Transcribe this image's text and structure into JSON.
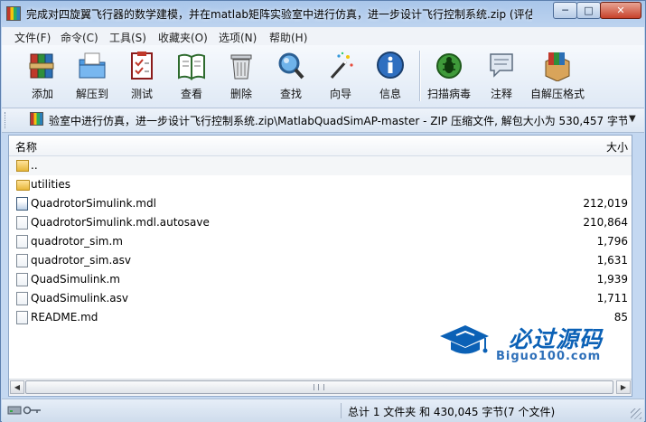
{
  "window": {
    "title": "完成对四旋翼飞行器的数学建模，并在matlab矩阵实验室中进行仿真，进一步设计飞行控制系统.zip (评估",
    "minimize": "─",
    "maximize": "□",
    "close": "✕"
  },
  "menu": [
    "文件(F)",
    "命令(C)",
    "工具(S)",
    "收藏夹(O)",
    "选项(N)",
    "帮助(H)"
  ],
  "toolbar": {
    "add": "添加",
    "extract": "解压到",
    "test": "测试",
    "view": "查看",
    "delete": "删除",
    "find": "查找",
    "wizard": "向导",
    "info": "信息",
    "scan": "扫描病毒",
    "comment": "注释",
    "sfx": "自解压格式"
  },
  "address": {
    "path": "验室中进行仿真，进一步设计飞行控制系统.zip\\MatlabQuadSimAP-master - ZIP 压缩文件, 解包大小为 530,457 字节",
    "dropdown": "▼"
  },
  "list": {
    "col_name": "名称",
    "col_size": "大小",
    "files": [
      {
        "name": "..",
        "size": "",
        "type": "up"
      },
      {
        "name": "utilities",
        "size": "",
        "type": "folder"
      },
      {
        "name": "QuadrotorSimulink.mdl",
        "size": "212,019",
        "type": "mdl"
      },
      {
        "name": "QuadrotorSimulink.mdl.autosave",
        "size": "210,864",
        "type": "doc"
      },
      {
        "name": "quadrotor_sim.m",
        "size": "1,796",
        "type": "doc"
      },
      {
        "name": "quadrotor_sim.asv",
        "size": "1,631",
        "type": "doc"
      },
      {
        "name": "QuadSimulink.m",
        "size": "1,939",
        "type": "doc"
      },
      {
        "name": "QuadSimulink.asv",
        "size": "1,711",
        "type": "doc"
      },
      {
        "name": "README.md",
        "size": "85",
        "type": "doc"
      }
    ]
  },
  "watermark": {
    "title": "必过源码",
    "subtitle": "Biguo100.com"
  },
  "scroll": {
    "left": "◀",
    "right": "▶"
  },
  "status": {
    "summary": "总计 1 文件夹 和 430,045 字节(7 个文件)"
  }
}
